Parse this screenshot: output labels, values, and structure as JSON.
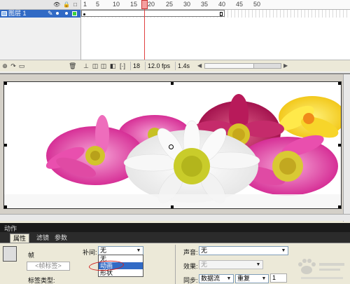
{
  "timeline": {
    "layer_name": "图层 1",
    "ruler_ticks": [
      "1",
      "5",
      "10",
      "15",
      "20",
      "25",
      "30",
      "35",
      "40",
      "45",
      "50"
    ],
    "current_frame": "18",
    "fps": "12.0 fps",
    "time": "1.4s"
  },
  "panels": {
    "actions_label": "动作",
    "tabs": [
      "属性",
      "滤镜",
      "参数"
    ],
    "frame_label": "帧",
    "frame_label_placeholder": "<帧标签>",
    "label_type": "标签类型:",
    "tween": {
      "label": "补间:",
      "selected": "无",
      "options": [
        "无",
        "动画",
        "形状"
      ]
    },
    "sound": {
      "label": "声音:",
      "value": "无"
    },
    "effect": {
      "label": "效果:",
      "value": "无"
    },
    "sync": {
      "label": "同步:",
      "value": "数据流",
      "repeat": "重复",
      "count": "1"
    }
  },
  "colors": {
    "selection_blue": "#316ac5",
    "playhead_red": "#e04040",
    "annotation_red": "#d02020"
  }
}
